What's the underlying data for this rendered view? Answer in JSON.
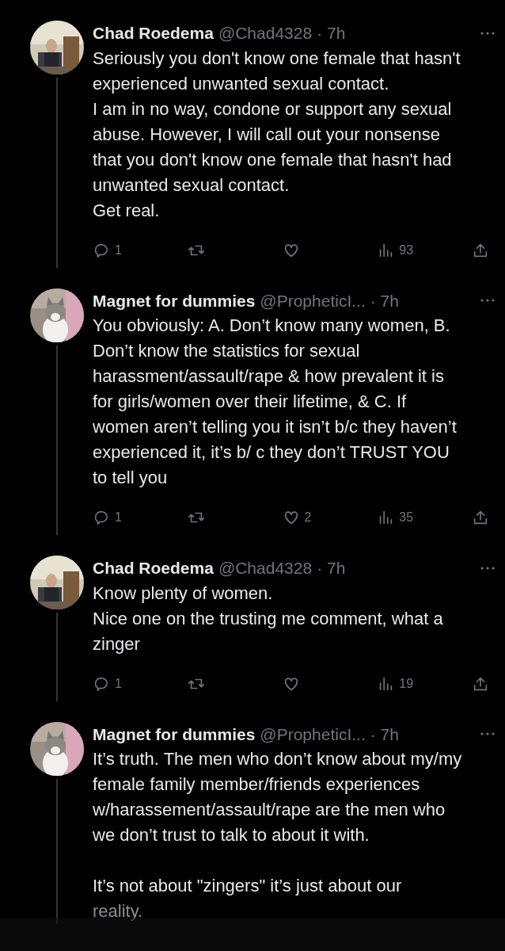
{
  "tweets": [
    {
      "name": "Chad Roedema",
      "handle": "@Chad4328",
      "time": "· 7h",
      "text": "Seriously you don't know one female that hasn't experienced unwanted sexual contact.\nI am in no way, condone or support any sexual abuse. However, I will call out your nonsense that you don't know one female that hasn't had unwanted sexual contact.\nGet real.",
      "replies": "1",
      "views": "93",
      "liked": false
    },
    {
      "name": "Magnet for dummies",
      "handle": "@PropheticI...",
      "time": "· 7h",
      "text": "You obviously: A. Don’t know many women, B. Don’t know the statistics for sexual harassment/assault/rape & how prevalent it is for girls/women over their lifetime, & C. If women aren’t telling you it isn’t b/c they haven’t experienced it, it’s b/ c they don’t TRUST YOU to tell you",
      "replies": "1",
      "likes": "2",
      "views": "35",
      "liked": false
    },
    {
      "name": "Chad Roedema",
      "handle": "@Chad4328",
      "time": "· 7h",
      "text": "Know plenty of women.\nNice one on the trusting me comment, what a zinger",
      "replies": "1",
      "views": "19",
      "liked": false
    },
    {
      "name": "Magnet for dummies",
      "handle": "@PropheticI...",
      "time": "· 7h",
      "text": "It’s truth. The men who don’t know about my/my female family member/friends experiences w/harassement/assault/rape are the men who we don’t trust to talk to about it with.\n\nIt’s not about \"zingers\" it’s just about our",
      "tail": "reality."
    }
  ]
}
